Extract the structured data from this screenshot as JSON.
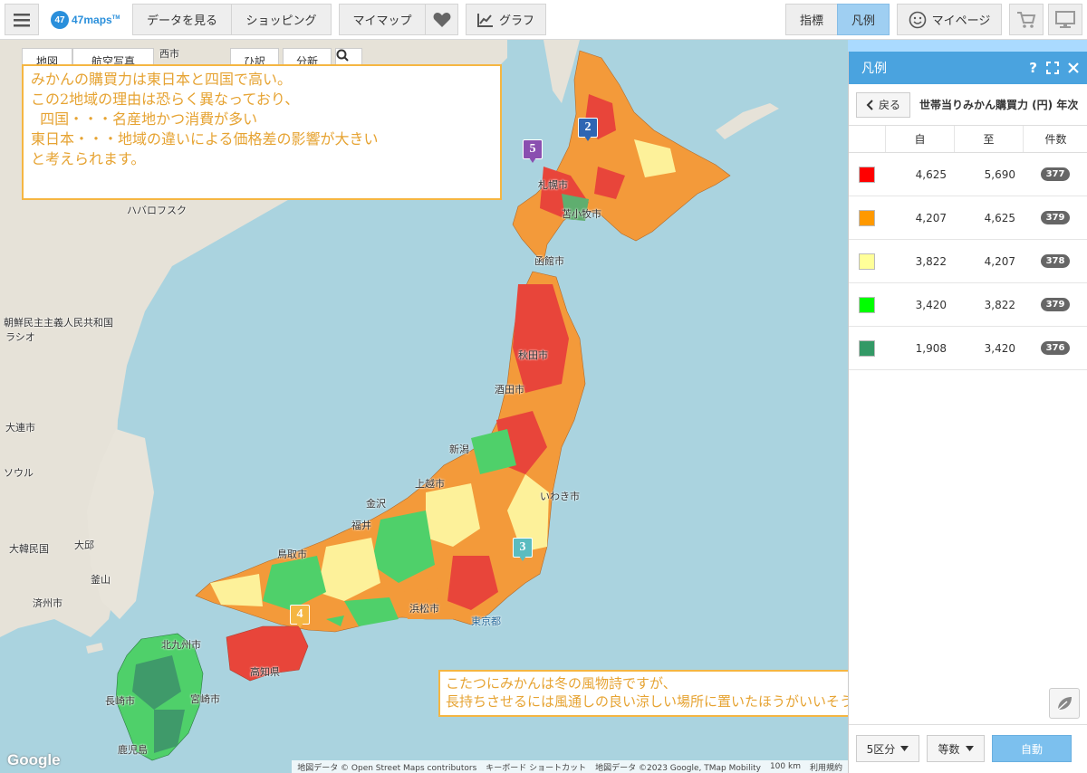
{
  "toolbar": {
    "logo_mark": "47",
    "logo_text": "47maps",
    "logo_tm": "TM",
    "view_data": "データを見る",
    "shopping": "ショッピング",
    "mymap": "マイマップ",
    "graph": "グラフ",
    "indicator": "指標",
    "legend": "凡例",
    "mypage": "マイページ"
  },
  "map": {
    "controls": {
      "map_type": "地図",
      "aerial": "航空写真",
      "filter1": "ひ訳",
      "filter2": "分新"
    },
    "labels": [
      {
        "text": "西市"
      },
      {
        "text": "札幌市"
      },
      {
        "text": "苫小牧市"
      },
      {
        "text": "函館市"
      },
      {
        "text": "秋田市"
      },
      {
        "text": "酒田市"
      },
      {
        "text": "新潟"
      },
      {
        "text": "上越市"
      },
      {
        "text": "いわき市"
      },
      {
        "text": "金沢"
      },
      {
        "text": "福井"
      },
      {
        "text": "鳥取市"
      },
      {
        "text": "浜松市"
      },
      {
        "text": "北九州市"
      },
      {
        "text": "高知県"
      },
      {
        "text": "長崎市"
      },
      {
        "text": "宮崎市"
      },
      {
        "text": "鹿児島"
      },
      {
        "text": "東京都"
      },
      {
        "text": "ハバロフスク"
      },
      {
        "text": "ラシオ"
      },
      {
        "text": "大連市"
      },
      {
        "text": "大邱"
      },
      {
        "text": "釜山"
      },
      {
        "text": "ソウル"
      },
      {
        "text": "済州市"
      },
      {
        "text": "大韓民国"
      },
      {
        "text": "朝鮮民主主義人民共和国"
      }
    ],
    "pins": [
      {
        "num": "2",
        "color": "#2f66b3"
      },
      {
        "num": "5",
        "color": "#8a4fb0"
      },
      {
        "num": "3",
        "color": "#5bbcc0"
      },
      {
        "num": "4",
        "color": "#f5b642"
      }
    ],
    "note_top": [
      "みかんの購買力は東日本と四国で高い。",
      "この2地域の理由は恐らく異なっており、",
      "  四国・・・名産地かつ消費が多い",
      "東日本・・・地域の違いによる価格差の影響が大きい",
      "",
      "と考えられます。"
    ],
    "note_bottom": [
      "こたつにみかんは冬の風物詩ですが、",
      "長持ちさせるには風通しの良い涼しい場所に置いたほうがいいそうです。"
    ],
    "google": "Google",
    "attribution": [
      "地図データ © Open Street Maps contributors",
      "キーボード ショートカット",
      "地図データ ©2023 Google, TMap Mobility",
      "100 km",
      "利用規約"
    ]
  },
  "panel": {
    "title": "凡例",
    "back": "戻る",
    "subtitle": "世帯当りみかん購買力 (円) 年次",
    "columns": [
      "",
      "自",
      "至",
      "件数"
    ],
    "rows": [
      {
        "color": "#ff0000",
        "from": "4,625",
        "to": "5,690",
        "count": "377"
      },
      {
        "color": "#ff9900",
        "from": "4,207",
        "to": "4,625",
        "count": "379"
      },
      {
        "color": "#ffff99",
        "from": "3,822",
        "to": "4,207",
        "count": "378"
      },
      {
        "color": "#00ff00",
        "from": "3,420",
        "to": "3,822",
        "count": "379"
      },
      {
        "color": "#339966",
        "from": "1,908",
        "to": "3,420",
        "count": "376"
      }
    ],
    "divisions": "5区分",
    "method": "等数",
    "auto": "自動"
  }
}
